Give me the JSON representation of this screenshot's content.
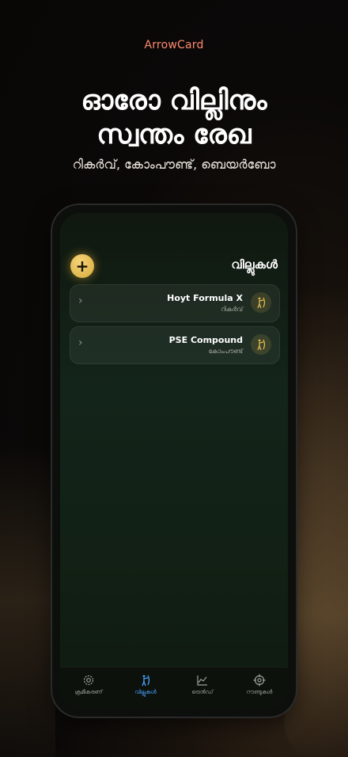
{
  "app_name": "ArrowCard",
  "headline": {
    "line1": "ഓരോ വില്ലിനും",
    "line2": "സ്വന്തം രേഖ"
  },
  "subline": "റികർവ്, കോംപൗണ്ട്, ബെയർബോ",
  "screen": {
    "title": "വില്ലുകൾ",
    "add_label": "+",
    "bows": [
      {
        "name": "Hoyt Formula X",
        "type": "റികർവ്"
      },
      {
        "name": "PSE Compound",
        "type": "കോംപൗണ്ട്"
      }
    ],
    "chevron": "›"
  },
  "tabs": [
    {
      "label": "ക്രമീകരണ്",
      "icon": "gear-icon"
    },
    {
      "label": "വില്ലുകൾ",
      "icon": "archer-icon",
      "active": true
    },
    {
      "label": "ട്രെൻഡ്",
      "icon": "chart-icon"
    },
    {
      "label": "റൗണ്ടുകൾ",
      "icon": "target-icon"
    }
  ],
  "colors": {
    "accent": "#ff8a70",
    "gold": "#e6b850",
    "active_tab": "#4aa3ff"
  }
}
